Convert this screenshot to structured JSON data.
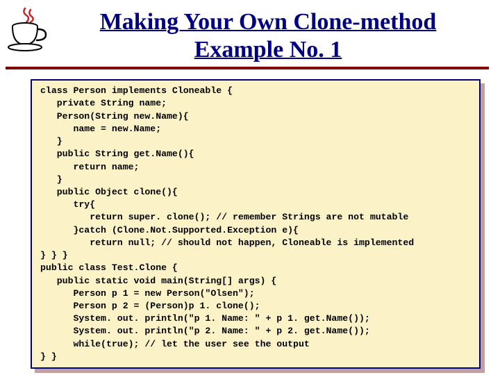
{
  "title": {
    "line1": "Making Your Own Clone-method",
    "line2": "Example No. 1"
  },
  "code": {
    "l1": "class Person implements Cloneable {",
    "l2": "   private String name;",
    "l3": "   Person(String new.Name){",
    "l4": "      name = new.Name;",
    "l5": "   }",
    "l6": "   public String get.Name(){",
    "l7": "      return name;",
    "l8": "   }",
    "l9": "   public Object clone(){",
    "l10": "      try{",
    "l11a": "         return super. clone(); ",
    "l11c": "// remember Strings are not mutable",
    "l12": "      }catch (Clone.Not.Supported.Exception e){",
    "l13a": "         return null; ",
    "l13c": "// should not happen, Cloneable is implemented",
    "l14": "} } }",
    "l15": "public class Test.Clone {",
    "l16": "   public static void main(String[] args) {",
    "l17": "      Person p 1 = new Person(\"Olsen\");",
    "l18": "      Person p 2 = (Person)p 1. clone();",
    "l19": "      System. out. println(\"p 1. Name: \" + p 1. get.Name());",
    "l20": "      System. out. println(\"p 2. Name: \" + p 2. get.Name());",
    "l21a": "      while(true); ",
    "l21c": "// let the user see the output",
    "l22": "} }"
  }
}
